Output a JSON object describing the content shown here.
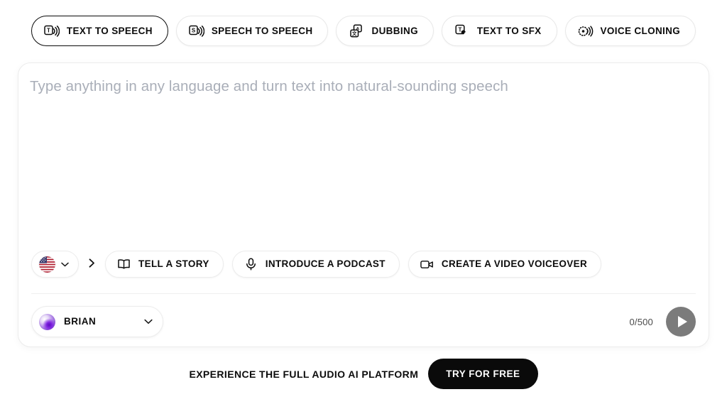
{
  "tabs": [
    {
      "label": "TEXT TO SPEECH",
      "icon": "text-to-speech-icon",
      "active": true
    },
    {
      "label": "SPEECH TO SPEECH",
      "icon": "speech-to-speech-icon",
      "active": false
    },
    {
      "label": "DUBBING",
      "icon": "dubbing-translate-icon",
      "active": false
    },
    {
      "label": "TEXT TO SFX",
      "icon": "text-to-sfx-icon",
      "active": false
    },
    {
      "label": "VOICE CLONING",
      "icon": "voice-cloning-icon",
      "active": false
    }
  ],
  "editor": {
    "placeholder": "Type anything in any language and turn text into natural-sounding speech",
    "value": ""
  },
  "language": {
    "flag": "us-flag-icon",
    "chevron": "chevron-down-icon"
  },
  "presets": [
    {
      "label": "TELL A STORY",
      "icon": "book-icon"
    },
    {
      "label": "INTRODUCE A PODCAST",
      "icon": "microphone-icon"
    },
    {
      "label": "CREATE A VIDEO VOICEOVER",
      "icon": "video-camera-icon"
    }
  ],
  "voice": {
    "name": "BRIAN",
    "avatar": "voice-avatar-orb",
    "chevron": "chevron-down-icon"
  },
  "counter": "0/500",
  "play_button": "play-icon",
  "footer": {
    "text": "EXPERIENCE THE FULL AUDIO AI PLATFORM",
    "cta": "TRY FOR FREE"
  },
  "colors": {
    "accent_black": "#0a0a0a",
    "placeholder_gray": "#a9aeb8",
    "play_gray": "#7b7b7b",
    "border_gray": "#ececec"
  }
}
